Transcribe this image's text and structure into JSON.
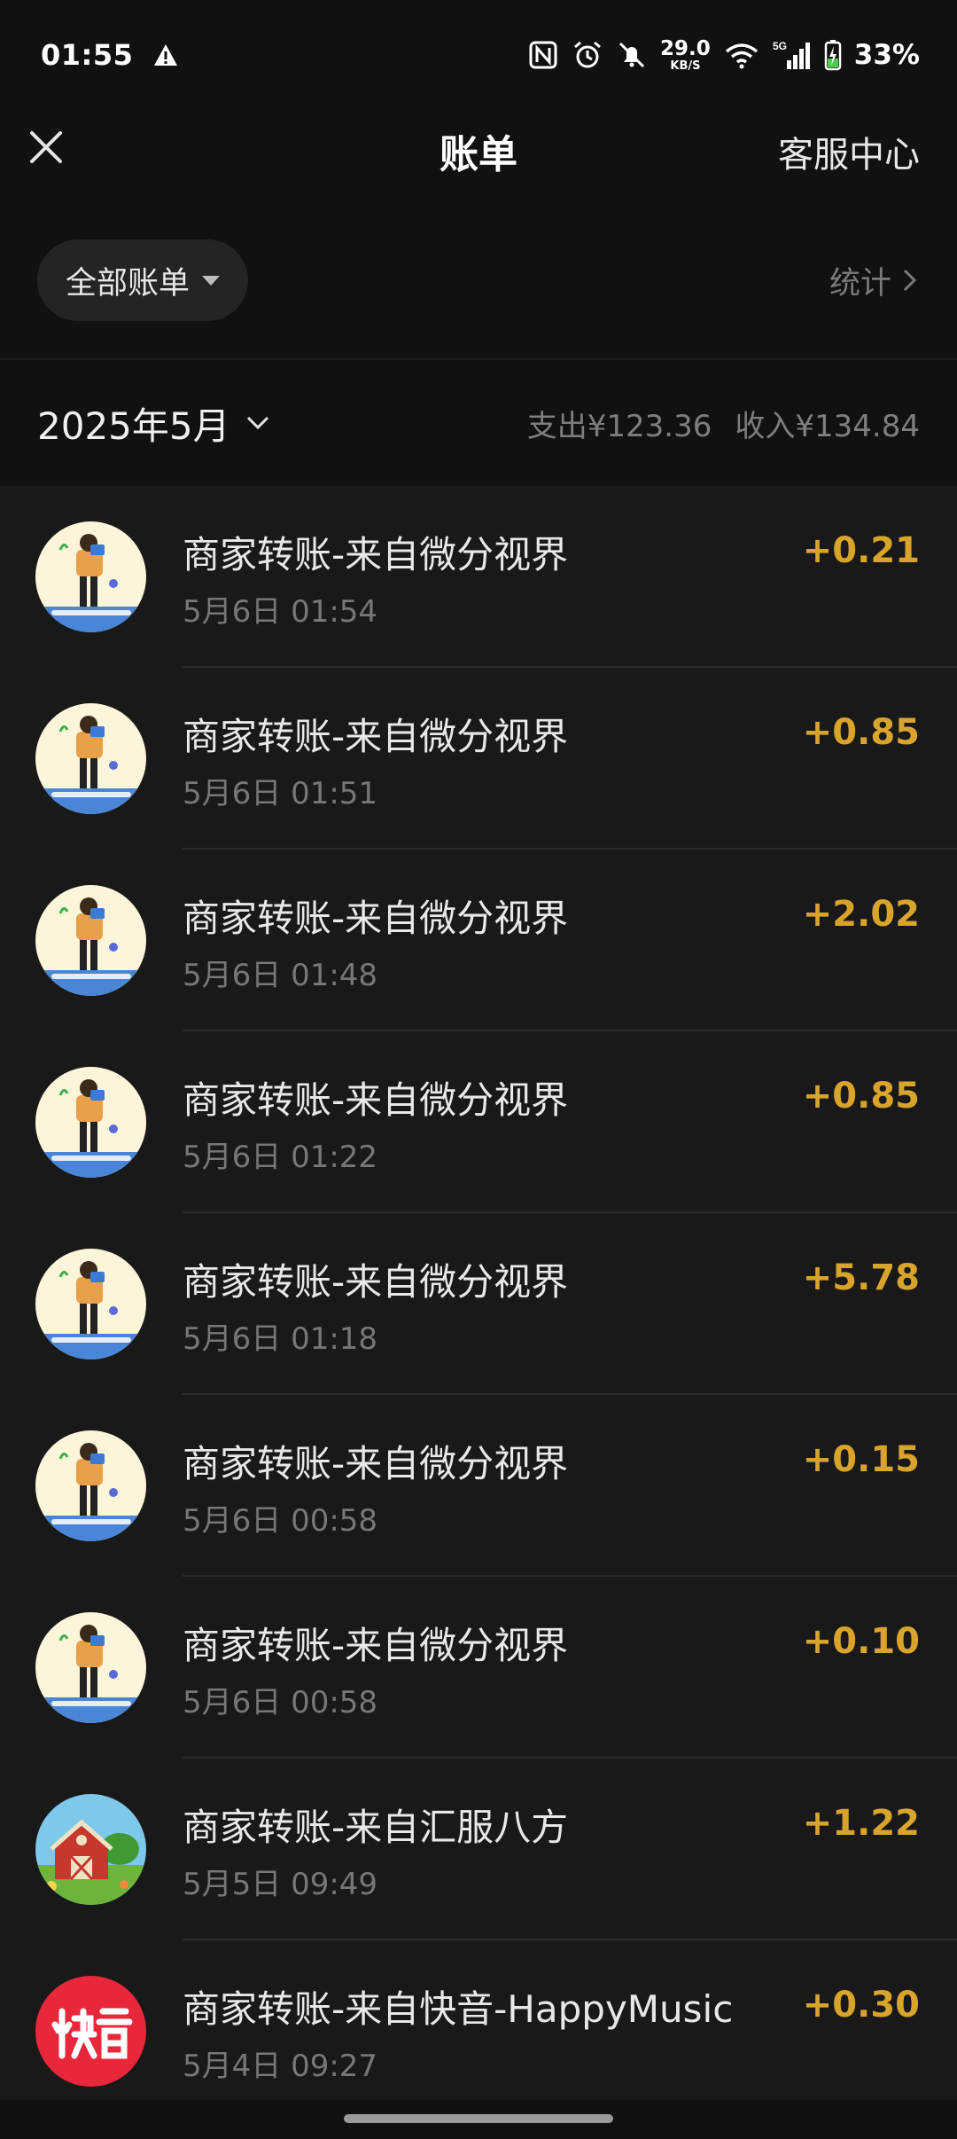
{
  "status_bar": {
    "time": "01:55",
    "net_speed_value": "29.0",
    "net_speed_unit": "KB/S",
    "network_label": "5G",
    "battery": "33%"
  },
  "header": {
    "title": "账单",
    "service_label": "客服中心"
  },
  "filter": {
    "label": "全部账单",
    "stats_label": "统计"
  },
  "month": {
    "label": "2025年5月",
    "expense": "支出¥123.36",
    "income": "收入¥134.84"
  },
  "colors": {
    "background": "#111111",
    "list_background": "#191919",
    "income_amount": "#d9a42c"
  },
  "transactions": [
    {
      "title": "商家转账-来自微分视界",
      "time": "5月6日 01:54",
      "amount": "+0.21",
      "avatar": "music-challenge-avatar"
    },
    {
      "title": "商家转账-来自微分视界",
      "time": "5月6日 01:51",
      "amount": "+0.85",
      "avatar": "music-challenge-avatar"
    },
    {
      "title": "商家转账-来自微分视界",
      "time": "5月6日 01:48",
      "amount": "+2.02",
      "avatar": "music-challenge-avatar"
    },
    {
      "title": "商家转账-来自微分视界",
      "time": "5月6日 01:22",
      "amount": "+0.85",
      "avatar": "music-challenge-avatar"
    },
    {
      "title": "商家转账-来自微分视界",
      "time": "5月6日 01:18",
      "amount": "+5.78",
      "avatar": "music-challenge-avatar"
    },
    {
      "title": "商家转账-来自微分视界",
      "time": "5月6日 00:58",
      "amount": "+0.15",
      "avatar": "music-challenge-avatar"
    },
    {
      "title": "商家转账-来自微分视界",
      "time": "5月6日 00:58",
      "amount": "+0.10",
      "avatar": "music-challenge-avatar"
    },
    {
      "title": "商家转账-来自汇服八方",
      "time": "5月5日 09:49",
      "amount": "+1.22",
      "avatar": "farm-barn-avatar"
    },
    {
      "title": "商家转账-来自快音-HappyMusic",
      "time": "5月4日 09:27",
      "amount": "+0.30",
      "avatar": "kuaiyin-logo-avatar"
    }
  ]
}
